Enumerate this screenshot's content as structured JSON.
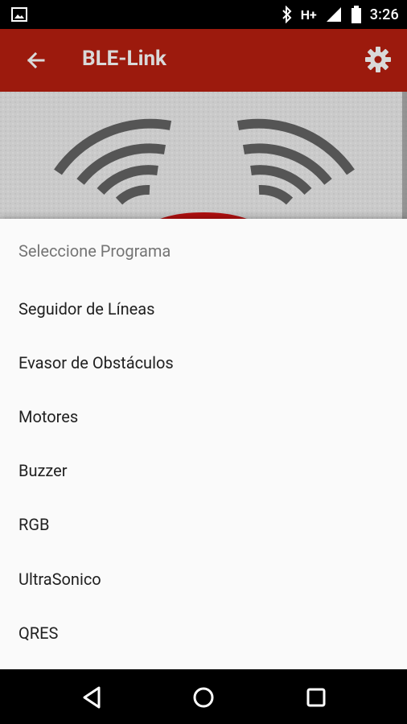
{
  "status_bar": {
    "time": "3:26",
    "network": "H+",
    "icons": [
      "image-icon",
      "bluetooth-icon",
      "signal-icon",
      "battery-icon"
    ]
  },
  "app_bar": {
    "title": "BLE-Link",
    "back_icon": "back-arrow-icon",
    "settings_icon": "gear-icon",
    "color": "#9c1a0d"
  },
  "sheet": {
    "title": "Seleccione Programa",
    "items": [
      {
        "label": "Seguidor de Líneas"
      },
      {
        "label": "Evasor de Obstáculos"
      },
      {
        "label": "Motores"
      },
      {
        "label": "Buzzer"
      },
      {
        "label": "RGB"
      },
      {
        "label": "UltraSonico"
      },
      {
        "label": "QRES"
      }
    ]
  },
  "nav_bar": {
    "icons": [
      "back-triangle-icon",
      "home-circle-icon",
      "recents-square-icon"
    ]
  }
}
